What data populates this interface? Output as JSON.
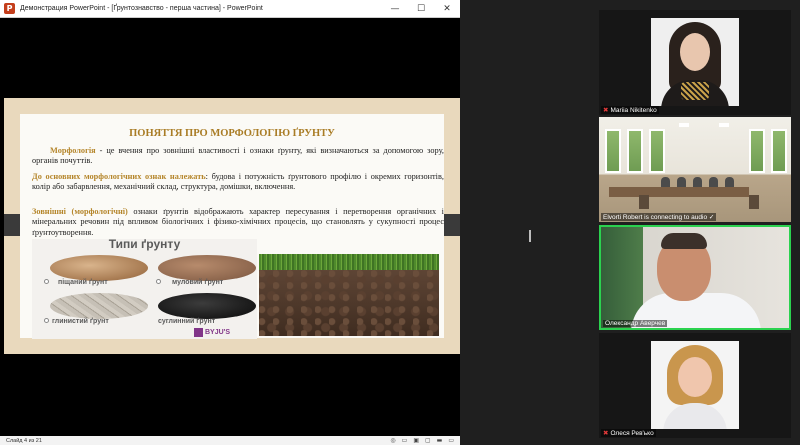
{
  "window": {
    "title": "Демонстрация PowerPoint - [Ґрунтознавство - перша частина] - PowerPoint",
    "app_icon": "P",
    "controls": {
      "minimize": "—",
      "maximize": "☐",
      "close": "✕"
    }
  },
  "slide": {
    "heading": "ПОНЯТТЯ ПРО МОРФОЛОГІЮ ҐРУНТУ",
    "p1_term": "Морфологія",
    "p1_text": " - це вчення про зовнішні властивості і ознаки ґрунту, які визначаються за допомогою зору, органів почуттів.",
    "p2_term": "До основних морфологічних ознак належать",
    "p2_text": ": будова і потужність ґрунтового профілю і окремих горизонтів, колір або забарвлення, механічний склад, структура, домішки, включення.",
    "p3_term": "Зовнішні (морфологічні)",
    "p3_text": " ознаки ґрунтів відображають характер пересування і перетворення органічних і мінеральних речовин під впливом біологічних і фізико-хімічних процесів, що становлять у сукупності процес ґрунтоутворення.",
    "soil_types": {
      "title": "Типи ґрунту",
      "sand": "піщаний ґрунт",
      "loam": "муловий ґрунт",
      "clay": "глинистий ґрунт",
      "black": "суглинний ґрунт",
      "brand": "BYJU'S"
    }
  },
  "statusbar": {
    "slide_counter": "Слайд 4 из 21",
    "icons": [
      "◎",
      "▭",
      "▣",
      "▢",
      "▬",
      "▭"
    ]
  },
  "participants": [
    {
      "name": "Mariia Nikitenko",
      "muted": true
    },
    {
      "name": "Elvorti Robert is connecting to audio ✓",
      "muted": false
    },
    {
      "name": "Олександр Аверчев",
      "muted": false
    },
    {
      "name": "Олеся Рев'ько",
      "muted": true
    }
  ],
  "colors": {
    "accent_green": "#2bd24f",
    "heading_gold": "#a97c25",
    "mic_red": "#e23a3a"
  }
}
